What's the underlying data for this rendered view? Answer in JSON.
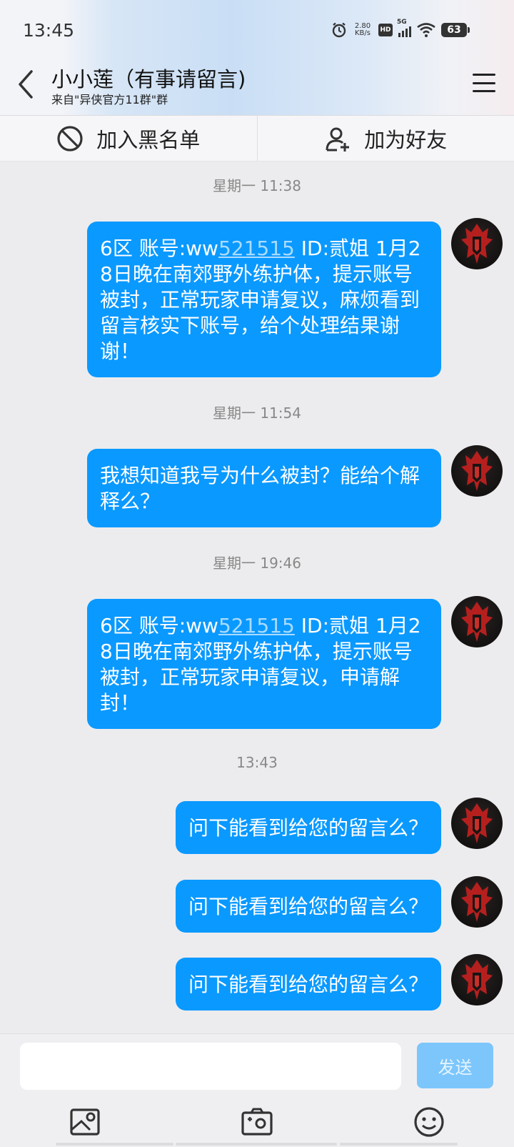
{
  "status_bar": {
    "time": "13:45",
    "net_speed_value": "2.80",
    "net_speed_unit": "KB/s",
    "hd_label": "HD",
    "network_label": "5G",
    "battery": "63"
  },
  "header": {
    "title": "小小莲（有事请留言)",
    "subtitle": "来自\"异侠官方11群\"群"
  },
  "actions": {
    "blacklist_label": "加入黑名单",
    "add_friend_label": "加为好友"
  },
  "messages": [
    {
      "timestamp": "星期一 11:38",
      "pre": "6区  账号:ww",
      "link": "521515",
      "post": "  ID:贰姐  1月28日晚在南郊野外练护体，提示账号被封，正常玩家申请复议，麻烦看到留言核实下账号，给个处理结果谢谢！"
    },
    {
      "timestamp": "星期一 11:54",
      "text": "我想知道我号为什么被封？能给个解释么？"
    },
    {
      "timestamp": "星期一 19:46",
      "pre": "6区  账号:ww",
      "link": "521515",
      "post": "  ID:贰姐  1月28日晚在南郊野外练护体，提示账号被封，正常玩家申请复议，申请解封！"
    },
    {
      "timestamp": "13:43",
      "text": "问下能看到给您的留言么？"
    },
    {
      "text": "问下能看到给您的留言么？"
    },
    {
      "text": "问下能看到给您的留言么？"
    }
  ],
  "composer": {
    "placeholder": "",
    "send_label": "发送"
  },
  "icons": {
    "back": "chevron-left-icon",
    "menu": "hamburger-menu-icon",
    "blacklist": "block-icon",
    "add_friend": "add-user-icon",
    "image": "image-icon",
    "camera": "camera-icon",
    "emoji": "emoji-icon"
  },
  "colors": {
    "bubble": "#0a99ff",
    "link": "#a9dbff",
    "send_button": "#7cc6fb",
    "background": "#ececee"
  }
}
